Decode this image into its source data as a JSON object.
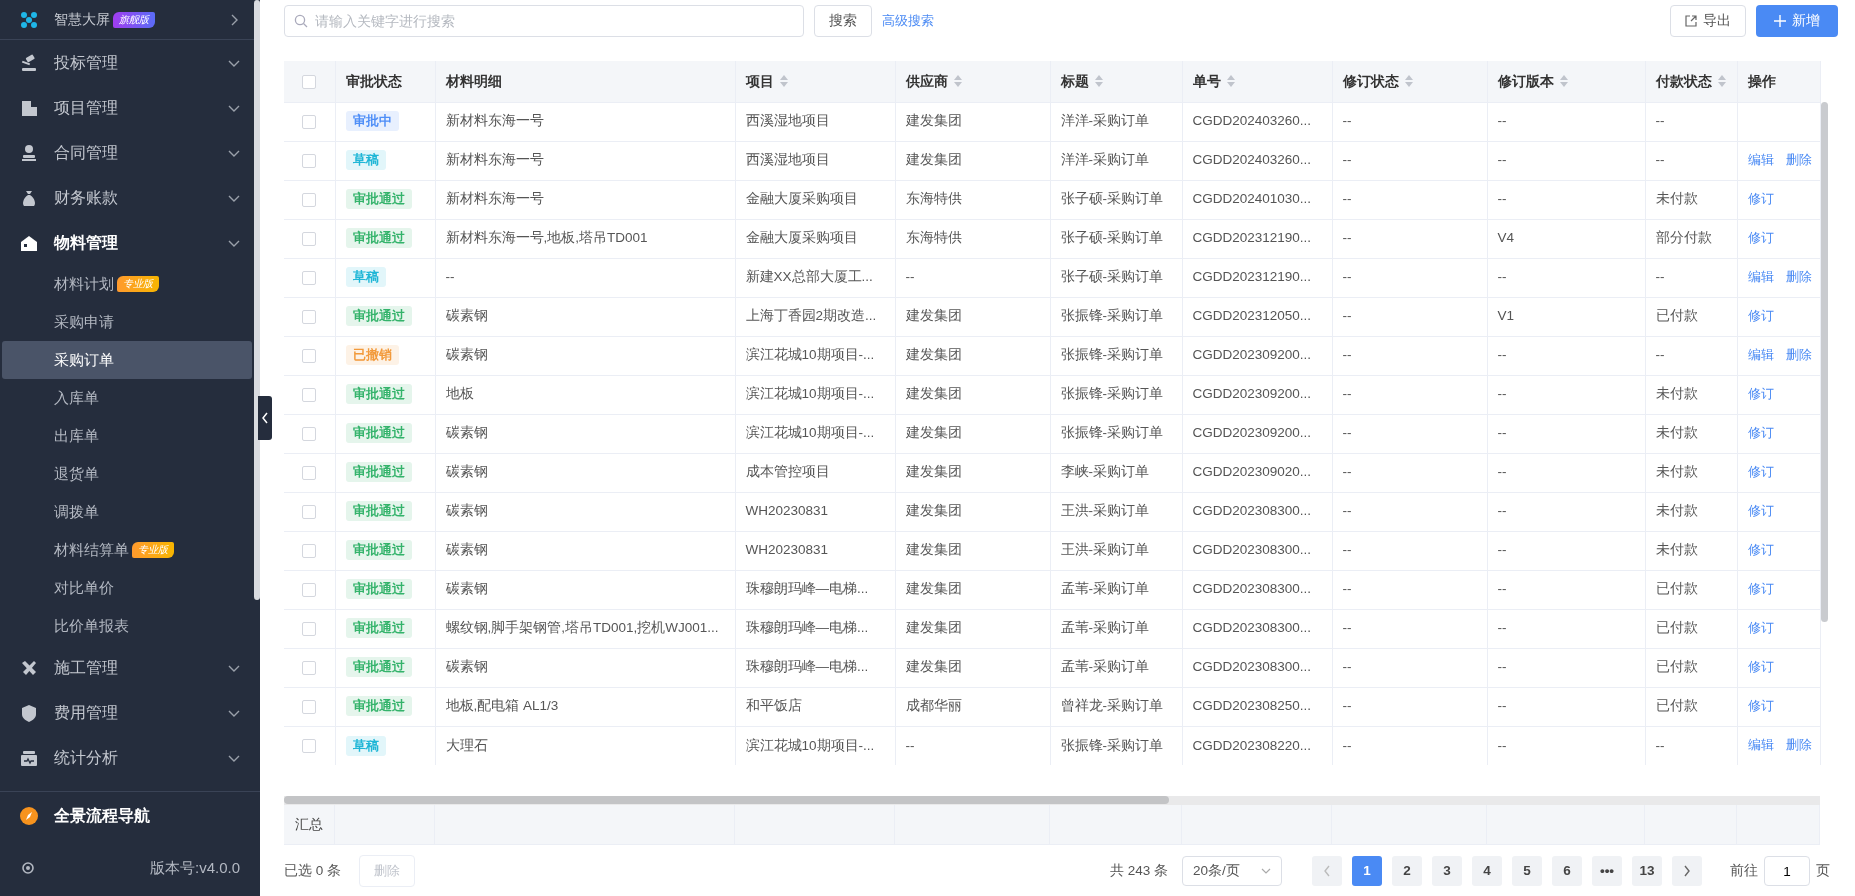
{
  "sidebar": {
    "top_item": {
      "label": "智慧大屏",
      "badge": "旗舰版"
    },
    "items": [
      {
        "label": "投标管理",
        "expanded": false
      },
      {
        "label": "项目管理",
        "expanded": false
      },
      {
        "label": "合同管理",
        "expanded": false
      },
      {
        "label": "财务账款",
        "expanded": false
      },
      {
        "label": "物料管理",
        "expanded": true,
        "children": [
          {
            "label": "材料计划",
            "badge": "专业版",
            "selected": false
          },
          {
            "label": "采购申请",
            "selected": false
          },
          {
            "label": "采购订单",
            "selected": true
          },
          {
            "label": "入库单",
            "selected": false
          },
          {
            "label": "出库单",
            "selected": false
          },
          {
            "label": "退货单",
            "selected": false
          },
          {
            "label": "调拨单",
            "selected": false
          },
          {
            "label": "材料结算单",
            "badge": "专业版",
            "selected": false
          },
          {
            "label": "对比单价",
            "selected": false
          },
          {
            "label": "比价单报表",
            "selected": false
          }
        ]
      },
      {
        "label": "施工管理",
        "expanded": false
      },
      {
        "label": "费用管理",
        "expanded": false
      },
      {
        "label": "统计分析",
        "expanded": false
      }
    ],
    "nav_link": "全景流程导航",
    "version": "版本号:v4.0.0"
  },
  "toolbar": {
    "search": {
      "placeholder": "请输入关键字进行搜索"
    },
    "search_button": "搜索",
    "advanced_link": "高级搜索",
    "export_button": "导出",
    "add_button": "新增"
  },
  "table": {
    "header_checked": false,
    "status_column": "审批状态",
    "columns": [
      {
        "label": "材料明细",
        "sortable": false
      },
      {
        "label": "项目",
        "sortable": true
      },
      {
        "label": "供应商",
        "sortable": true
      },
      {
        "label": "标题",
        "sortable": true
      },
      {
        "label": "单号",
        "sortable": true
      },
      {
        "label": "修订状态",
        "sortable": true
      },
      {
        "label": "修订版本",
        "sortable": true
      },
      {
        "label": "付款状态",
        "sortable": true
      }
    ],
    "actions_column": "操作",
    "rows": [
      {
        "checked": false,
        "status": {
          "label": "审批中",
          "color": "#4e8ef7"
        },
        "cells": [
          "新材料东海一号",
          "西溪湿地项目",
          "建发集团",
          "洋洋-采购订单",
          "CGDD202403260...",
          "--",
          "--",
          "--"
        ],
        "actions": []
      },
      {
        "checked": false,
        "status": {
          "label": "草稿",
          "color": "#1fb6d6"
        },
        "cells": [
          "新材料东海一号",
          "西溪湿地项目",
          "建发集团",
          "洋洋-采购订单",
          "CGDD202403260...",
          "--",
          "--",
          "--"
        ],
        "actions": [
          "编辑",
          "删除"
        ]
      },
      {
        "checked": false,
        "status": {
          "label": "审批通过",
          "color": "#34b36b"
        },
        "cells": [
          "新材料东海一号",
          "金融大厦采购项目",
          "东海特供",
          "张子硕-采购订单",
          "CGDD202401030...",
          "--",
          "--",
          "未付款"
        ],
        "actions": [
          "修订"
        ]
      },
      {
        "checked": false,
        "status": {
          "label": "审批通过",
          "color": "#34b36b"
        },
        "cells": [
          "新材料东海一号,地板,塔吊TD001",
          "金融大厦采购项目",
          "东海特供",
          "张子硕-采购订单",
          "CGDD202312190...",
          "--",
          "V4",
          "部分付款"
        ],
        "actions": [
          "修订"
        ]
      },
      {
        "checked": false,
        "status": {
          "label": "草稿",
          "color": "#1fb6d6"
        },
        "cells": [
          "--",
          "新建XX总部大厦工...",
          "--",
          "张子硕-采购订单",
          "CGDD202312190...",
          "--",
          "--",
          "--"
        ],
        "actions": [
          "编辑",
          "删除"
        ]
      },
      {
        "checked": false,
        "status": {
          "label": "审批通过",
          "color": "#34b36b"
        },
        "cells": [
          "碳素钢",
          "上海丁香园2期改造...",
          "建发集团",
          "张振锋-采购订单",
          "CGDD202312050...",
          "--",
          "V1",
          "已付款"
        ],
        "actions": [
          "修订"
        ]
      },
      {
        "checked": false,
        "status": {
          "label": "已撤销",
          "color": "#f29a3b"
        },
        "cells": [
          "碳素钢",
          "滨江花城10期项目-...",
          "建发集团",
          "张振锋-采购订单",
          "CGDD202309200...",
          "--",
          "--",
          "--"
        ],
        "actions": [
          "编辑",
          "删除"
        ]
      },
      {
        "checked": false,
        "status": {
          "label": "审批通过",
          "color": "#34b36b"
        },
        "cells": [
          "地板",
          "滨江花城10期项目-...",
          "建发集团",
          "张振锋-采购订单",
          "CGDD202309200...",
          "--",
          "--",
          "未付款"
        ],
        "actions": [
          "修订"
        ]
      },
      {
        "checked": false,
        "status": {
          "label": "审批通过",
          "color": "#34b36b"
        },
        "cells": [
          "碳素钢",
          "滨江花城10期项目-...",
          "建发集团",
          "张振锋-采购订单",
          "CGDD202309200...",
          "--",
          "--",
          "未付款"
        ],
        "actions": [
          "修订"
        ]
      },
      {
        "checked": false,
        "status": {
          "label": "审批通过",
          "color": "#34b36b"
        },
        "cells": [
          "碳素钢",
          "成本管控项目",
          "建发集团",
          "李峡-采购订单",
          "CGDD202309020...",
          "--",
          "--",
          "未付款"
        ],
        "actions": [
          "修订"
        ]
      },
      {
        "checked": false,
        "status": {
          "label": "审批通过",
          "color": "#34b36b"
        },
        "cells": [
          "碳素钢",
          "WH20230831",
          "建发集团",
          "王洪-采购订单",
          "CGDD202308300...",
          "--",
          "--",
          "未付款"
        ],
        "actions": [
          "修订"
        ]
      },
      {
        "checked": false,
        "status": {
          "label": "审批通过",
          "color": "#34b36b"
        },
        "cells": [
          "碳素钢",
          "WH20230831",
          "建发集团",
          "王洪-采购订单",
          "CGDD202308300...",
          "--",
          "--",
          "未付款"
        ],
        "actions": [
          "修订"
        ]
      },
      {
        "checked": false,
        "status": {
          "label": "审批通过",
          "color": "#34b36b"
        },
        "cells": [
          "碳素钢",
          "珠穆朗玛峰—电梯...",
          "建发集团",
          "孟苇-采购订单",
          "CGDD202308300...",
          "--",
          "--",
          "已付款"
        ],
        "actions": [
          "修订"
        ]
      },
      {
        "checked": false,
        "status": {
          "label": "审批通过",
          "color": "#34b36b"
        },
        "cells": [
          "螺纹钢,脚手架钢管,塔吊TD001,挖机WJ001...",
          "珠穆朗玛峰—电梯...",
          "建发集团",
          "孟苇-采购订单",
          "CGDD202308300...",
          "--",
          "--",
          "已付款"
        ],
        "actions": [
          "修订"
        ]
      },
      {
        "checked": false,
        "status": {
          "label": "审批通过",
          "color": "#34b36b"
        },
        "cells": [
          "碳素钢",
          "珠穆朗玛峰—电梯...",
          "建发集团",
          "孟苇-采购订单",
          "CGDD202308300...",
          "--",
          "--",
          "已付款"
        ],
        "actions": [
          "修订"
        ]
      },
      {
        "checked": false,
        "status": {
          "label": "审批通过",
          "color": "#34b36b"
        },
        "cells": [
          "地板,配电箱 AL1/3",
          "和平饭店",
          "成都华丽",
          "曾祥龙-采购订单",
          "CGDD202308250...",
          "--",
          "--",
          "已付款"
        ],
        "actions": [
          "修订"
        ]
      },
      {
        "checked": false,
        "status": {
          "label": "草稿",
          "color": "#1fb6d6"
        },
        "cells": [
          "大理石",
          "滨江花城10期项目-...",
          "--",
          "张振锋-采购订单",
          "CGDD202308220...",
          "--",
          "--",
          "--"
        ],
        "actions": [
          "编辑",
          "删除"
        ]
      }
    ],
    "summary_label": "汇总"
  },
  "footer": {
    "selected_text": "已选 0 条",
    "delete_button": {
      "label": "删除",
      "disabled": true
    },
    "total": "共 243 条",
    "page_size": "20条/页",
    "pages": [
      {
        "label": "1",
        "selected": true
      },
      {
        "label": "2",
        "selected": false
      },
      {
        "label": "3",
        "selected": false
      },
      {
        "label": "4",
        "selected": false
      },
      {
        "label": "5",
        "selected": false
      },
      {
        "label": "6",
        "selected": false
      },
      {
        "label": "•••",
        "selected": false
      },
      {
        "label": "13",
        "selected": false
      }
    ],
    "jump_label": "前往",
    "jump_value": "1",
    "jump_suffix": "页"
  }
}
